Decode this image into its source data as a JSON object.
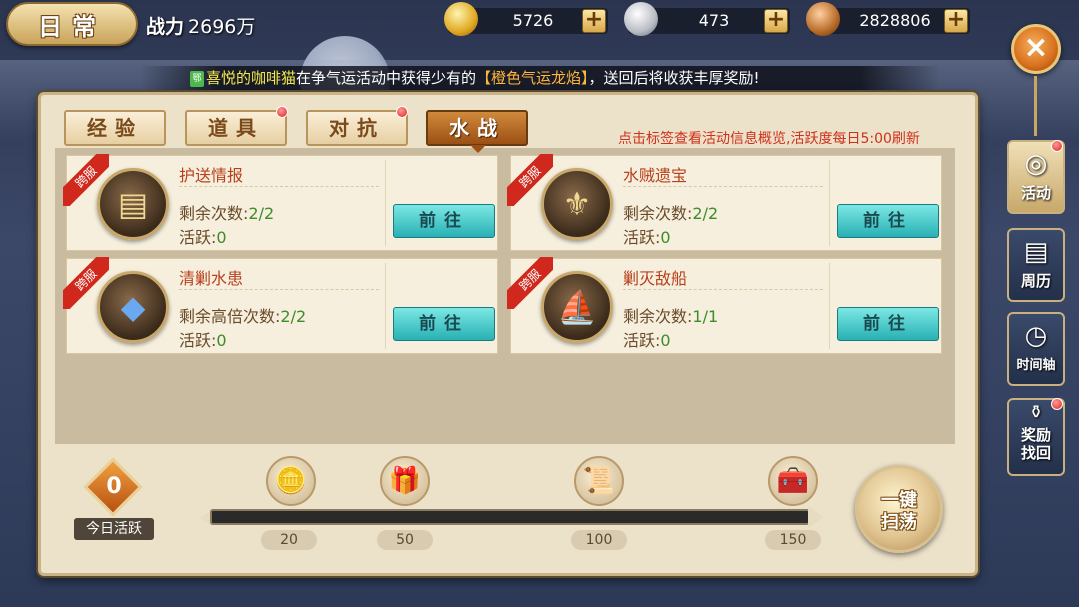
{
  "header": {
    "title": "日常",
    "power_label": "战力",
    "power_value": "2696万"
  },
  "currencies": [
    {
      "icon": "gold-ingot-icon",
      "value": "5726",
      "plus": "+"
    },
    {
      "icon": "silver-ingot-icon",
      "value": "473",
      "plus": "+"
    },
    {
      "icon": "copper-coin-icon",
      "value": "2828806",
      "plus": "+"
    }
  ],
  "close_label": "×",
  "broadcast": {
    "server_tag": "鄂",
    "player": "喜悦的咖啡猫",
    "text1": "在争气运活动中获得少有的",
    "item": "【橙色气运龙焰】",
    "text2": "，送回后将收获丰厚奖励!"
  },
  "sidebar": [
    {
      "label": "活动",
      "glyph": "◎",
      "active": true
    },
    {
      "label": "周历",
      "glyph": "▤",
      "active": false
    },
    {
      "label": "时间轴",
      "glyph": "◷",
      "active": false
    },
    {
      "label": "奖励找回",
      "glyph": "⚱",
      "active": false
    }
  ],
  "tabs": [
    {
      "label": "经验",
      "active": false,
      "dot": false
    },
    {
      "label": "道具",
      "active": false,
      "dot": true
    },
    {
      "label": "对抗",
      "active": false,
      "dot": true
    },
    {
      "label": "水战",
      "active": true,
      "dot": false
    }
  ],
  "hint": "点击标签查看活动信息概览,活跃度每日5:00刷新",
  "cards": [
    {
      "ribbon": "跨服",
      "icon": "intel-scroll-icon",
      "name": "护送情报",
      "count_label": "剩余次数:",
      "count": "2/2",
      "active_label": "活跃:",
      "active": "0",
      "button": "前往"
    },
    {
      "ribbon": "跨服",
      "icon": "treasure-chest-icon",
      "name": "水贼遗宝",
      "count_label": "剩余次数:",
      "count": "2/2",
      "active_label": "活跃:",
      "active": "0",
      "button": "前往"
    },
    {
      "ribbon": "跨服",
      "icon": "sea-beast-icon",
      "name": "清剿水患",
      "count_label": "剩余高倍次数:",
      "count": "2/2",
      "active_label": "活跃:",
      "active": "0",
      "button": "前往"
    },
    {
      "ribbon": "跨服",
      "icon": "warship-icon",
      "name": "剿灭敌船",
      "count_label": "剩余次数:",
      "count": "1/1",
      "active_label": "活跃:",
      "active": "0",
      "button": "前往"
    }
  ],
  "today": {
    "value": "0",
    "label": "今日活跃"
  },
  "progress": {
    "current": 0,
    "max": 150
  },
  "milestones": [
    {
      "value": "20",
      "icon": "gold-ingot-reward-icon"
    },
    {
      "value": "50",
      "icon": "purple-chest-reward-icon"
    },
    {
      "value": "100",
      "icon": "scroll-reward-icon"
    },
    {
      "value": "150",
      "icon": "gold-chest-reward-icon"
    }
  ],
  "sweep_button": {
    "line1": "一键",
    "line2": "扫荡"
  }
}
